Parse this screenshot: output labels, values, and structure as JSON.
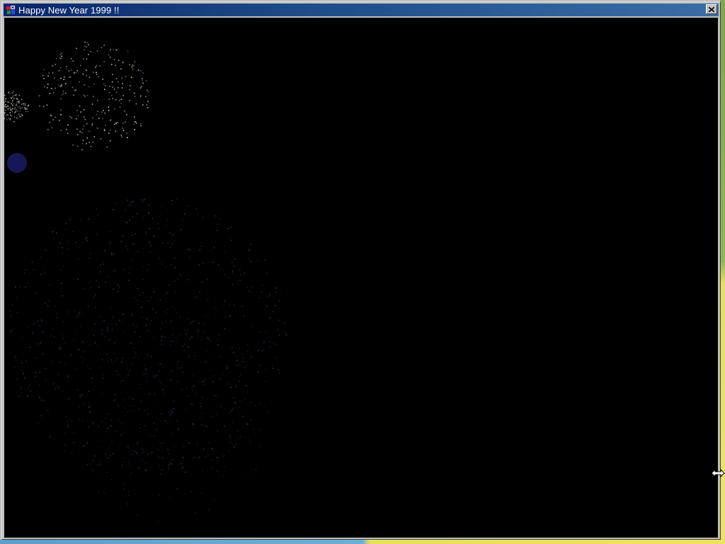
{
  "window": {
    "title": "Happy New Year 1999 !!",
    "app_icon": "directx-app-icon",
    "close_icon": "close-icon"
  },
  "canvas": {
    "background_color": "#000000",
    "scene": "fireworks-animation"
  },
  "cursor": {
    "icon": "horizontal-resize-cursor-icon"
  },
  "colors": {
    "title_bar_start": "#0a246a",
    "title_bar_end": "#3a6ea5",
    "frame": "#c0c0c0"
  }
}
